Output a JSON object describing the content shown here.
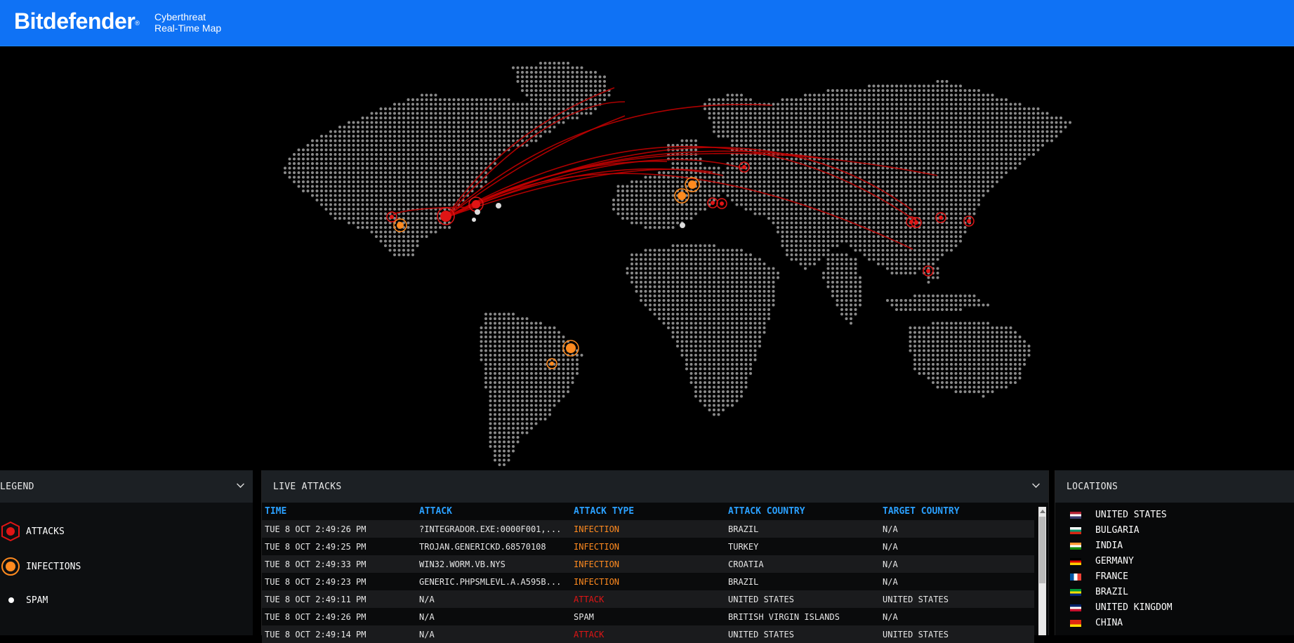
{
  "header": {
    "brand": "Bitdefender",
    "trademark": "®",
    "subtitle_line1": "Cyberthreat",
    "subtitle_line2": "Real-Time Map",
    "background_color": "#0f72f5"
  },
  "legend": {
    "title": "LEGEND",
    "items": [
      {
        "label": "ATTACKS",
        "icon": "attack-hexagon-icon",
        "color": "#e01515"
      },
      {
        "label": "INFECTIONS",
        "icon": "infection-ring-icon",
        "color": "#ff8a1f"
      },
      {
        "label": "SPAM",
        "icon": "spam-dot-icon",
        "color": "#ffffff"
      }
    ]
  },
  "live_attacks": {
    "title": "LIVE ATTACKS",
    "columns": [
      "TIME",
      "ATTACK",
      "ATTACK TYPE",
      "ATTACK COUNTRY",
      "TARGET COUNTRY"
    ],
    "rows": [
      {
        "time": "TUE 8 OCT 2:49:26 PM",
        "attack": "?INTEGRADOR.EXE:0000F001,...",
        "type": "INFECTION",
        "attack_country": "BRAZIL",
        "target_country": "N/A"
      },
      {
        "time": "TUE 8 OCT 2:49:25 PM",
        "attack": "TROJAN.GENERICKD.68570108",
        "type": "INFECTION",
        "attack_country": "TURKEY",
        "target_country": "N/A"
      },
      {
        "time": "TUE 8 OCT 2:49:33 PM",
        "attack": "WIN32.WORM.VB.NYS",
        "type": "INFECTION",
        "attack_country": "CROATIA",
        "target_country": "N/A"
      },
      {
        "time": "TUE 8 OCT 2:49:23 PM",
        "attack": "GENERIC.PHPSMLEVL.A.A595B...",
        "type": "INFECTION",
        "attack_country": "BRAZIL",
        "target_country": "N/A"
      },
      {
        "time": "TUE 8 OCT 2:49:11 PM",
        "attack": "N/A",
        "type": "ATTACK",
        "attack_country": "UNITED STATES",
        "target_country": "UNITED STATES"
      },
      {
        "time": "TUE 8 OCT 2:49:26 PM",
        "attack": "N/A",
        "type": "SPAM",
        "attack_country": "BRITISH VIRGIN ISLANDS",
        "target_country": "N/A"
      },
      {
        "time": "TUE 8 OCT 2:49:14 PM",
        "attack": "N/A",
        "type": "ATTACK",
        "attack_country": "UNITED STATES",
        "target_country": "UNITED STATES"
      }
    ]
  },
  "locations": {
    "title": "LOCATIONS",
    "items": [
      {
        "name": "UNITED STATES",
        "flag": "us-flag-icon"
      },
      {
        "name": "BULGARIA",
        "flag": "bg-flag-icon"
      },
      {
        "name": "INDIA",
        "flag": "in-flag-icon"
      },
      {
        "name": "GERMANY",
        "flag": "de-flag-icon"
      },
      {
        "name": "FRANCE",
        "flag": "fr-flag-icon"
      },
      {
        "name": "BRAZIL",
        "flag": "br-flag-icon"
      },
      {
        "name": "UNITED KINGDOM",
        "flag": "gb-flag-icon"
      },
      {
        "name": "CHINA",
        "flag": "cn-flag-icon"
      }
    ]
  }
}
